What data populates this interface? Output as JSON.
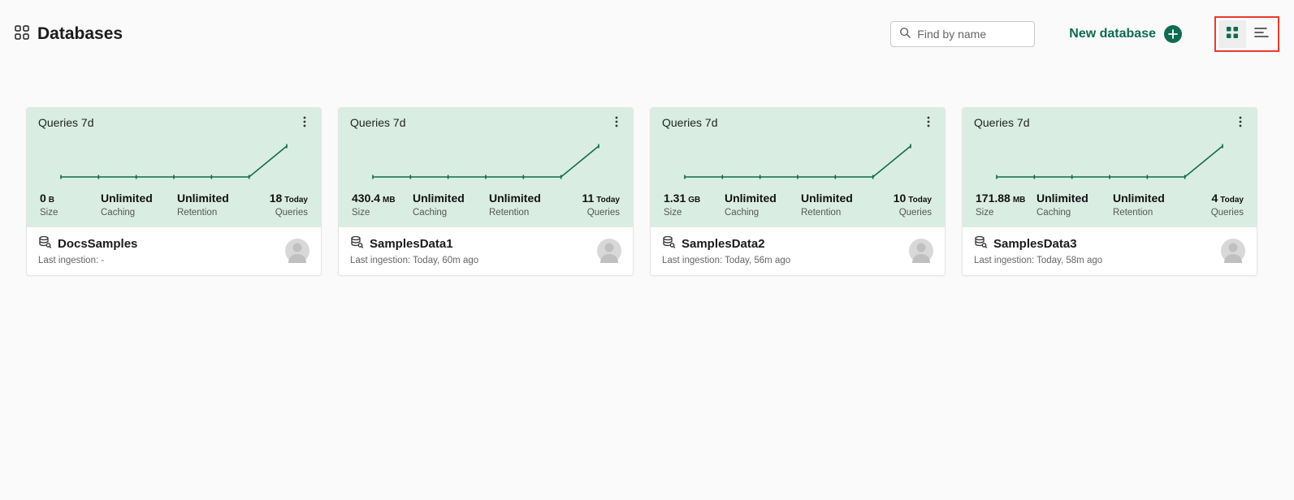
{
  "header": {
    "title": "Databases",
    "search_placeholder": "Find by name",
    "new_db_label": "New database"
  },
  "card_labels": {
    "queries7d": "Queries 7d",
    "size": "Size",
    "caching": "Caching",
    "retention": "Retention",
    "queries": "Queries",
    "last_ingestion_prefix": "Last ingestion: "
  },
  "databases": [
    {
      "name": "DocsSamples",
      "size_val": "0",
      "size_unit": "B",
      "caching": "Unlimited",
      "retention": "Unlimited",
      "queries_val": "18",
      "queries_unit": "Today",
      "last_ingestion": "-"
    },
    {
      "name": "SamplesData1",
      "size_val": "430.4",
      "size_unit": "MB",
      "caching": "Unlimited",
      "retention": "Unlimited",
      "queries_val": "11",
      "queries_unit": "Today",
      "last_ingestion": "Today, 60m ago"
    },
    {
      "name": "SamplesData2",
      "size_val": "1.31",
      "size_unit": "GB",
      "caching": "Unlimited",
      "retention": "Unlimited",
      "queries_val": "10",
      "queries_unit": "Today",
      "last_ingestion": "Today, 56m ago"
    },
    {
      "name": "SamplesData3",
      "size_val": "171.88",
      "size_unit": "MB",
      "caching": "Unlimited",
      "retention": "Unlimited",
      "queries_val": "4",
      "queries_unit": "Today",
      "last_ingestion": "Today, 58m ago"
    }
  ],
  "chart_data": [
    {
      "type": "line",
      "x": [
        0,
        1,
        2,
        3,
        4,
        5,
        6
      ],
      "y": [
        0,
        0,
        0,
        0,
        0,
        0,
        1
      ],
      "ylim": [
        0,
        1
      ],
      "title": "Queries 7d"
    },
    {
      "type": "line",
      "x": [
        0,
        1,
        2,
        3,
        4,
        5,
        6
      ],
      "y": [
        0,
        0,
        0,
        0,
        0,
        0,
        1
      ],
      "ylim": [
        0,
        1
      ],
      "title": "Queries 7d"
    },
    {
      "type": "line",
      "x": [
        0,
        1,
        2,
        3,
        4,
        5,
        6
      ],
      "y": [
        0,
        0,
        0,
        0,
        0,
        0,
        1
      ],
      "ylim": [
        0,
        1
      ],
      "title": "Queries 7d"
    },
    {
      "type": "line",
      "x": [
        0,
        1,
        2,
        3,
        4,
        5,
        6
      ],
      "y": [
        0,
        0,
        0,
        0,
        0,
        0,
        1
      ],
      "ylim": [
        0,
        1
      ],
      "title": "Queries 7d"
    }
  ]
}
